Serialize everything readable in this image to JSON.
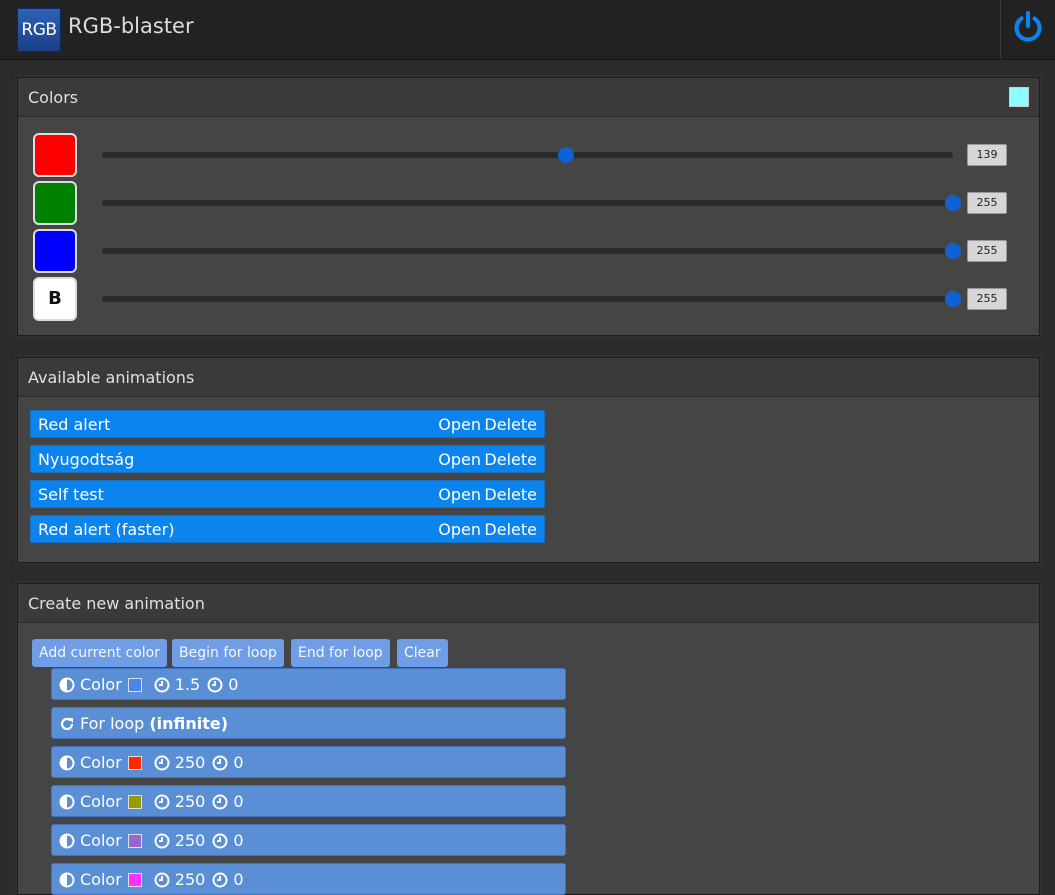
{
  "header": {
    "logo_text": "RGB",
    "app_title": "RGB-blaster",
    "power_icon": "power-icon",
    "accent": "#0b84ee"
  },
  "colors_panel": {
    "title": "Colors",
    "preview_color": "#8bffff",
    "channels": [
      {
        "name": "red",
        "label": "",
        "color": "#ff0000",
        "value": "139",
        "level": 139
      },
      {
        "name": "green",
        "label": "",
        "color": "#008000",
        "value": "255",
        "level": 255
      },
      {
        "name": "blue",
        "label": "",
        "color": "#0000ff",
        "value": "255",
        "level": 255
      },
      {
        "name": "brightness",
        "label": "B",
        "color": "#ffffff",
        "value": "255",
        "level": 255
      }
    ],
    "max": 255
  },
  "animations_panel": {
    "title": "Available animations",
    "items": [
      {
        "name": "Red alert",
        "open": "Open",
        "delete": "Delete"
      },
      {
        "name": "Nyugodtság",
        "open": "Open",
        "delete": "Delete"
      },
      {
        "name": "Self test",
        "open": "Open",
        "delete": "Delete"
      },
      {
        "name": "Red alert (faster)",
        "open": "Open",
        "delete": "Delete"
      }
    ]
  },
  "create_panel": {
    "title": "Create new animation",
    "buttons": {
      "add_color": "Add current color",
      "begin_loop": "Begin for loop",
      "end_loop": "End for loop",
      "clear": "Clear"
    },
    "steps": [
      {
        "type": "color",
        "label": "Color",
        "color": "#4a86e8",
        "duration": "1.5",
        "delay": "0"
      },
      {
        "type": "loop",
        "label": "For loop",
        "detail": "(infinite)"
      },
      {
        "type": "color",
        "label": "Color",
        "color": "#ff2a00",
        "duration": "250",
        "delay": "0"
      },
      {
        "type": "color",
        "label": "Color",
        "color": "#999900",
        "duration": "250",
        "delay": "0"
      },
      {
        "type": "color",
        "label": "Color",
        "color": "#9966cc",
        "duration": "250",
        "delay": "0"
      },
      {
        "type": "color",
        "label": "Color",
        "color": "#ff33ff",
        "duration": "250",
        "delay": "0"
      }
    ]
  }
}
